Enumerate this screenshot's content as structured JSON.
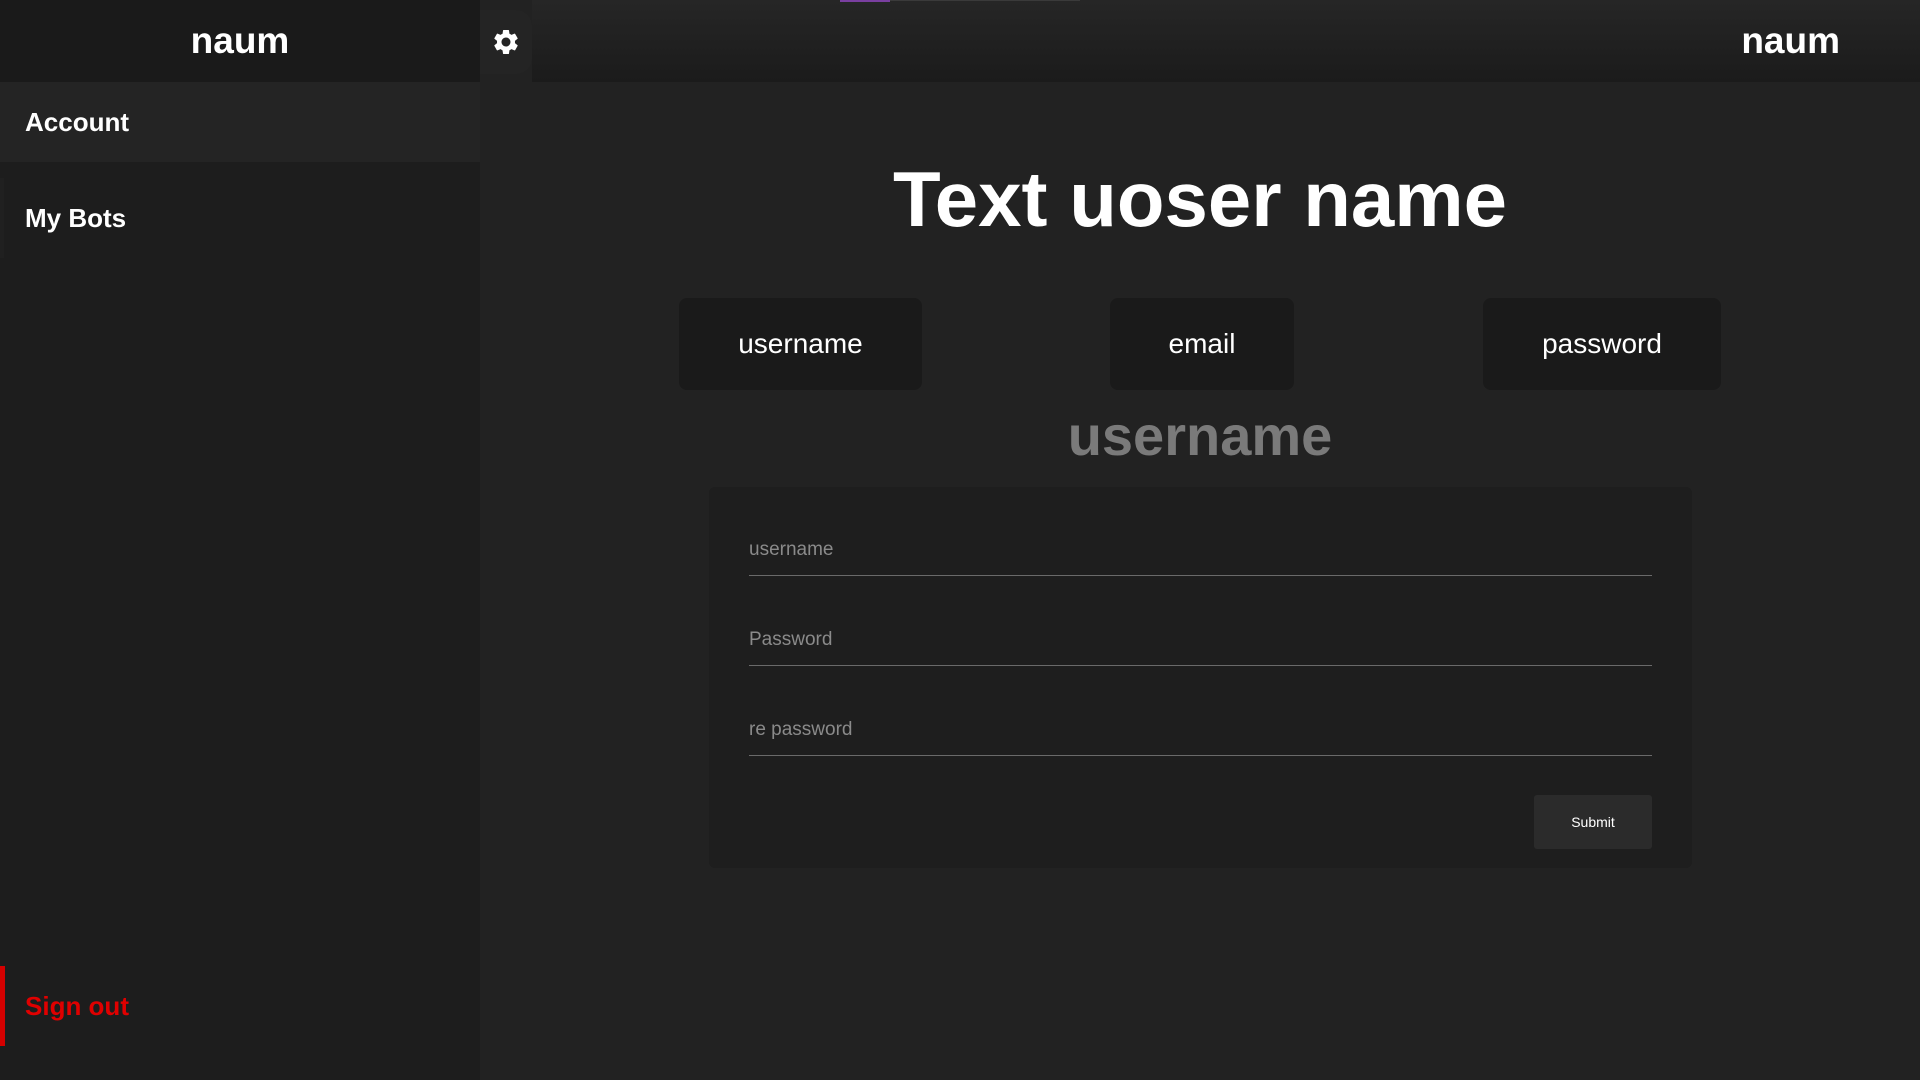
{
  "sidebar": {
    "brand": "naum",
    "items": [
      {
        "label": "Account"
      },
      {
        "label": "My Bots"
      }
    ],
    "sign_out_label": "Sign out"
  },
  "topbar": {
    "settings_icon": "gear-icon",
    "username": "naum"
  },
  "main": {
    "title": "Text uoser name",
    "tabs": [
      {
        "label": "username"
      },
      {
        "label": "email"
      },
      {
        "label": "password"
      }
    ],
    "section_title": "username",
    "form": {
      "fields": [
        {
          "placeholder": "username",
          "value": ""
        },
        {
          "placeholder": "Password",
          "value": ""
        },
        {
          "placeholder": "re password",
          "value": ""
        }
      ],
      "submit_label": "Submit"
    }
  },
  "colors": {
    "background": "#222222",
    "sidebar": "#1d1d1d",
    "danger": "#e00000",
    "accent": "#7a3fa0",
    "muted_text": "#7a7a7a"
  }
}
